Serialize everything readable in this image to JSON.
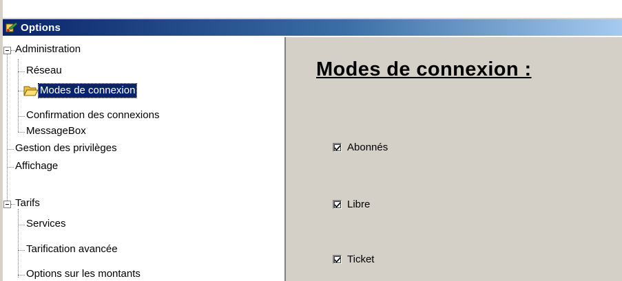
{
  "window": {
    "title": "Options"
  },
  "tree": {
    "items": [
      {
        "label": "Administration",
        "expander": "minus"
      },
      {
        "label": "Réseau"
      },
      {
        "label": "Modes de connexion",
        "selected": true,
        "icon": "open-folder-icon"
      },
      {
        "label": "Confirmation des connexions"
      },
      {
        "label": "MessageBox"
      },
      {
        "label": "Gestion des privilèges"
      },
      {
        "label": "Affichage"
      },
      {
        "label": "Tarifs",
        "expander": "minus"
      },
      {
        "label": "Services"
      },
      {
        "label": "Tarification avancée"
      },
      {
        "label": "Options sur les montants"
      }
    ]
  },
  "panel": {
    "heading": "Modes de connexion :",
    "options": [
      {
        "label": "Abonnés",
        "checked": true
      },
      {
        "label": "Libre",
        "checked": true
      },
      {
        "label": "Ticket",
        "checked": true
      }
    ]
  },
  "colors": {
    "titlebar_start": "#0a246a",
    "titlebar_end": "#a6caf0",
    "selection": "#0a246a",
    "panel_background": "#d4d0c8"
  }
}
